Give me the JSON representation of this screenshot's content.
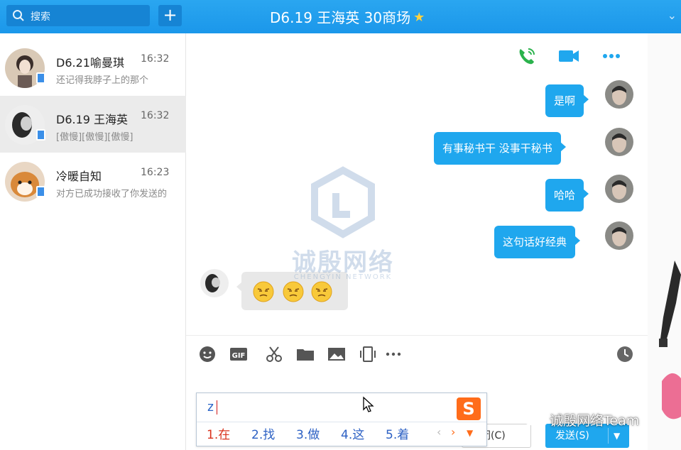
{
  "titlebar": {
    "search_placeholder": "搜索",
    "add_label": "+",
    "title": "D6.19 王海英 30商场",
    "title_icon": "star-icon"
  },
  "conversations": [
    {
      "name": "D6.21喻曼琪",
      "time": "16:32",
      "preview": "还记得我脖子上的那个",
      "active": false
    },
    {
      "name": "D6.19 王海英",
      "time": "16:32",
      "preview": "[傲慢][傲慢][傲慢]",
      "active": true
    },
    {
      "name": "冷暖自知",
      "time": "16:23",
      "preview": "对方已成功接收了你发送的",
      "active": false
    }
  ],
  "chat": {
    "top_actions": [
      "phone-call-icon",
      "video-call-icon",
      "more-icon"
    ],
    "messages": [
      {
        "direction": "out",
        "text": "是啊"
      },
      {
        "direction": "out",
        "text": "有事秘书干  没事干秘书"
      },
      {
        "direction": "out",
        "text": "哈哈"
      },
      {
        "direction": "out",
        "text": "这句话好经典"
      },
      {
        "direction": "in",
        "emoji": [
          "arrogant-emoji",
          "arrogant-emoji",
          "arrogant-emoji"
        ]
      }
    ],
    "tools": [
      "emoji-icon",
      "gif-icon",
      "screenshot-icon",
      "folder-icon",
      "image-icon",
      "shake-icon",
      "more-tools-icon",
      "history-icon"
    ],
    "close_label": "闭(C)",
    "send_label": "发送(S)"
  },
  "ime": {
    "typed": "z",
    "candidates": [
      "1.在",
      "2.找",
      "3.做",
      "4.这",
      "5.着"
    ],
    "logo": "S"
  },
  "watermark": {
    "title": "诚殷网络",
    "subtitle": "CHENGYIN NETWORK"
  },
  "wechat_tag": "诚殷网络Team",
  "colors": {
    "accent": "#1fa7ee",
    "titlebar": "#1b97ea",
    "ime_first": "#d9331d",
    "ime_candidate": "#2d61c4"
  }
}
